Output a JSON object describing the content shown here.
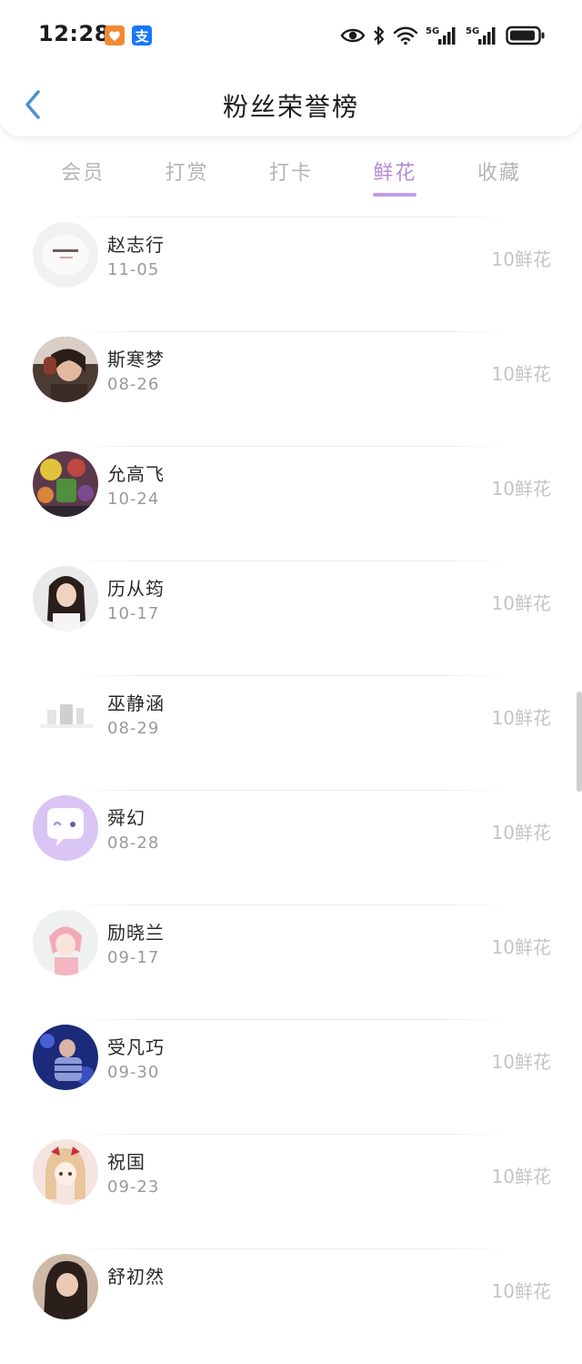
{
  "status_bar": {
    "time": "12:28",
    "notification_apps": [
      "shopping-app-icon",
      "alipay-icon"
    ],
    "indicators": [
      "eye-icon",
      "bluetooth-icon",
      "wifi-icon",
      "signal-5g-icon",
      "signal-5g-icon",
      "battery-icon"
    ],
    "signal_label_1": "5G",
    "signal_label_2": "5G",
    "alipay_char": "支"
  },
  "header": {
    "title": "粉丝荣誉榜",
    "back_icon": "chevron-left-icon"
  },
  "tabs": [
    {
      "label": "会员",
      "active": false
    },
    {
      "label": "打赏",
      "active": false
    },
    {
      "label": "打卡",
      "active": false
    },
    {
      "label": "鲜花",
      "active": true
    },
    {
      "label": "收藏",
      "active": false
    }
  ],
  "colors": {
    "accent": "#b48ad6",
    "back_icon": "#4a90d9",
    "muted_text": "#c4c4c4"
  },
  "fans": [
    {
      "name": "赵志行",
      "date": "11-05",
      "amount": "10鲜花"
    },
    {
      "name": "斯寒梦",
      "date": "08-26",
      "amount": "10鲜花"
    },
    {
      "name": "允高飞",
      "date": "10-24",
      "amount": "10鲜花"
    },
    {
      "name": "历从筠",
      "date": "10-17",
      "amount": "10鲜花"
    },
    {
      "name": "巫静涵",
      "date": "08-29",
      "amount": "10鲜花"
    },
    {
      "name": "舜幻",
      "date": "08-28",
      "amount": "10鲜花"
    },
    {
      "name": "励晓兰",
      "date": "09-17",
      "amount": "10鲜花"
    },
    {
      "name": "受凡巧",
      "date": "09-30",
      "amount": "10鲜花"
    },
    {
      "name": "祝国",
      "date": "09-23",
      "amount": "10鲜花"
    },
    {
      "name": "舒初然",
      "date": "",
      "amount": "10鲜花"
    }
  ]
}
